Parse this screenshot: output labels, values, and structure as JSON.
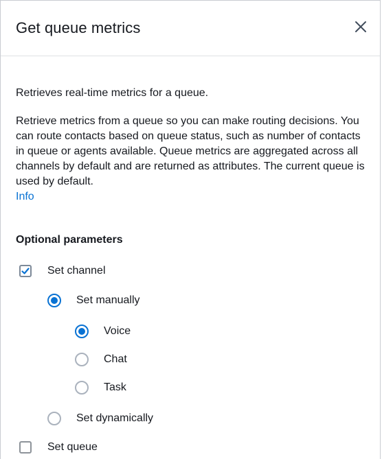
{
  "modal": {
    "title": "Get queue metrics",
    "close_icon": "close-icon"
  },
  "content": {
    "summary": "Retrieves real-time metrics for a queue.",
    "description": "Retrieve metrics from a queue so you can make routing decisions. You can route contacts based on queue status, such as number of contacts in queue or agents available. Queue metrics are aggregated across all channels by default and are returned as attributes. The current queue is used by default.",
    "info_link": "Info"
  },
  "optional_parameters": {
    "heading": "Optional parameters",
    "set_channel": {
      "label": "Set channel",
      "checked": true
    },
    "set_manually": {
      "label": "Set manually",
      "selected": true
    },
    "channels": [
      {
        "label": "Voice",
        "selected": true
      },
      {
        "label": "Chat",
        "selected": false
      },
      {
        "label": "Task",
        "selected": false
      }
    ],
    "set_dynamically": {
      "label": "Set dynamically",
      "selected": false
    },
    "set_queue": {
      "label": "Set queue",
      "checked": false
    }
  },
  "colors": {
    "accent": "#0972d3",
    "text": "#16191f",
    "border": "#c9ccd1"
  }
}
